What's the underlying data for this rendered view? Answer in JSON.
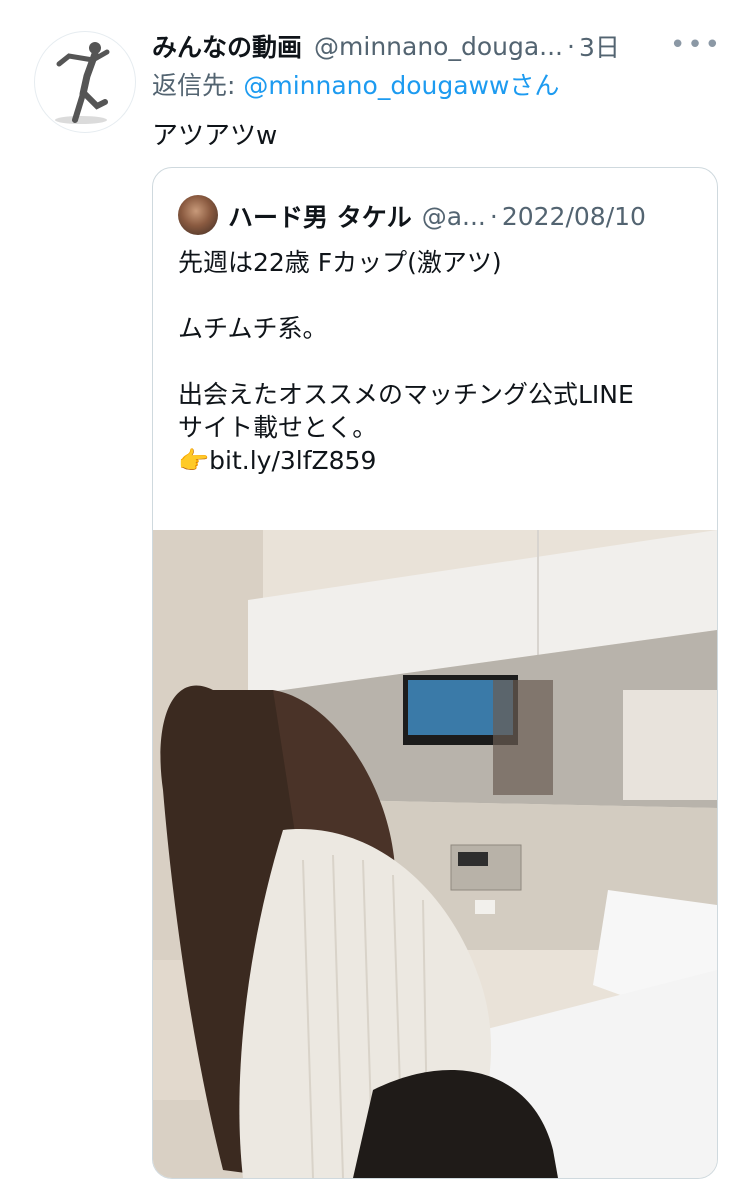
{
  "tweet": {
    "display_name": "みんなの動画",
    "handle": "@minnano_douga...",
    "separator": "·",
    "time": "3日",
    "more": "•••",
    "reply_prefix": "返信先: ",
    "reply_mention": "@minnano_dougawwさん",
    "text": "アツアツw"
  },
  "quote": {
    "display_name": "ハード男 タケル",
    "handle": "@a...",
    "separator": "·",
    "date": "2022/08/10",
    "lines": [
      "先週は22歳 Fカップ(激アツ)",
      "",
      "ムチムチ系。",
      "",
      "出会えたオススメのマッチング公式LINE",
      "サイト載せとく。"
    ],
    "link_emoji": "👉",
    "link_text": "bit.ly/3lfZ859"
  },
  "colors": {
    "primary_text": "#0f1419",
    "secondary_text": "#536471",
    "accent": "#1d9bf0",
    "border": "#cfd9de"
  }
}
